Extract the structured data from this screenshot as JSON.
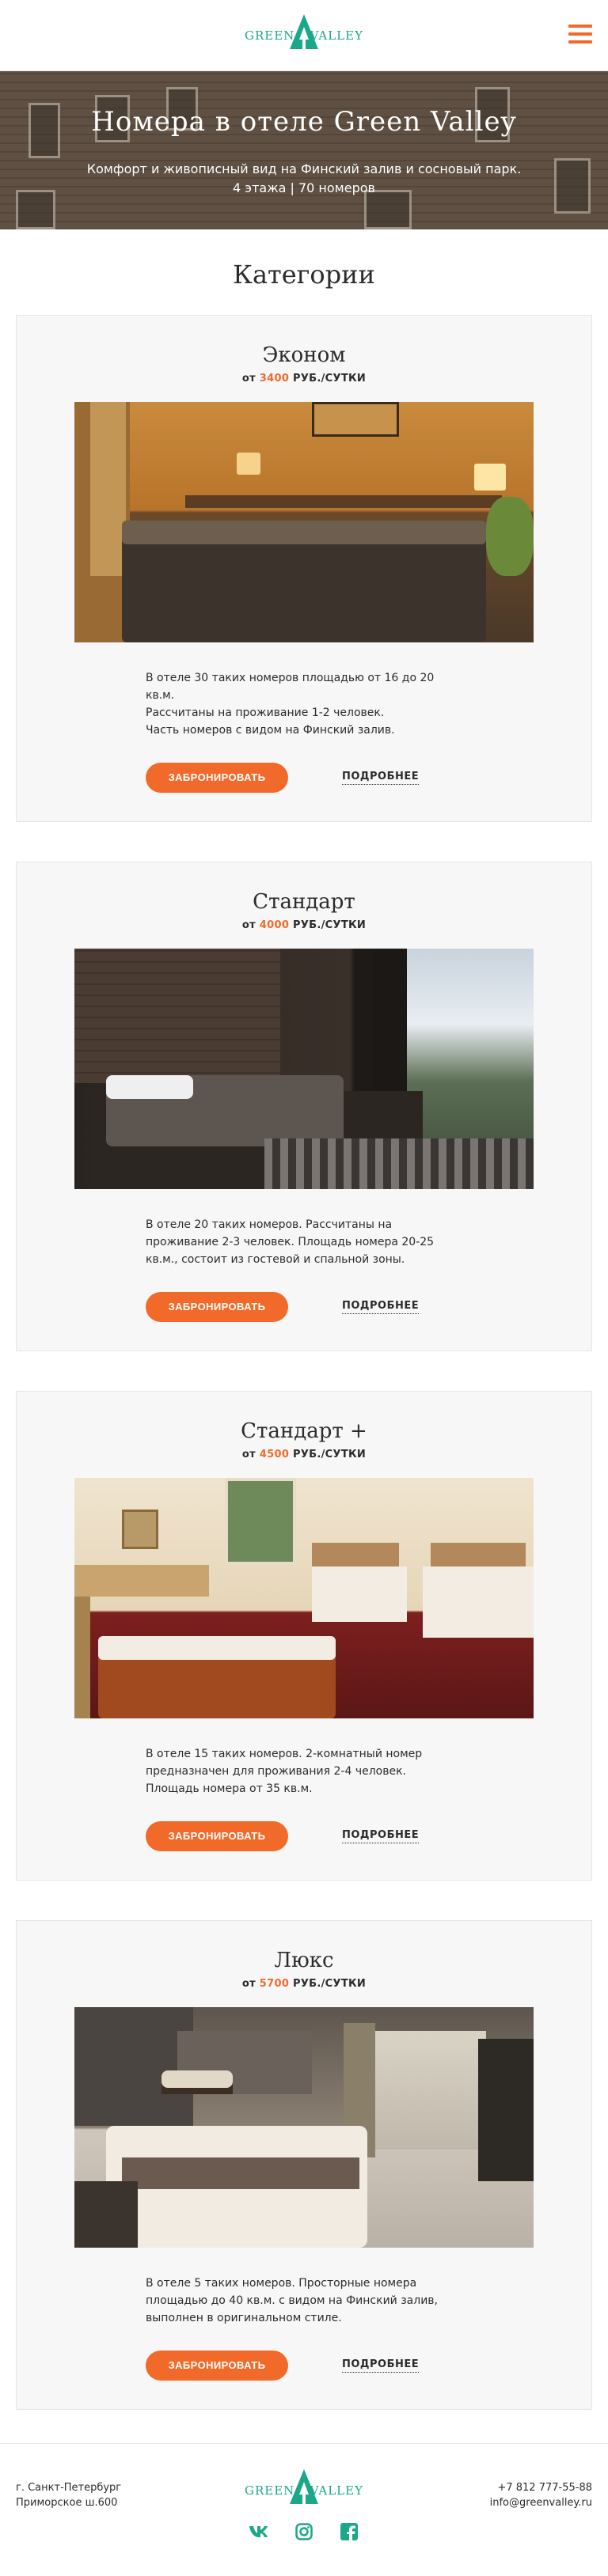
{
  "brand": {
    "left": "GREEN",
    "right": "VALLEY",
    "accent": "#1aa889",
    "orange": "#f26a2a"
  },
  "hero": {
    "title": "Номера в отеле Green Valley",
    "line1": "Комфорт и живописный вид на Финский залив и сосновый парк.",
    "line2": "4 этажа | 70 номеров"
  },
  "categories_title": "Категории",
  "rooms": [
    {
      "name": "Эконом",
      "from": "от",
      "price": "3400",
      "unit": "РУБ./СУТКИ",
      "desc": [
        "В отеле 30 таких номеров площадью от 16 до 20 кв.м.",
        "Рассчитаны на проживание 1-2 человек.",
        "Часть номеров с видом на Финский залив."
      ],
      "book": "ЗАБРОНИРОВАТЬ",
      "more": "ПОДРОБНЕЕ"
    },
    {
      "name": "Стандарт",
      "from": "от",
      "price": "4000",
      "unit": "РУБ./СУТКИ",
      "desc": [
        "В отеле 20 таких номеров. Рассчитаны на",
        "проживание 2-3 человек. Площадь номера 20-25",
        "кв.м., состоит из гостевой и спальной зоны."
      ],
      "book": "ЗАБРОНИРОВАТЬ",
      "more": "ПОДРОБНЕЕ"
    },
    {
      "name": "Стандарт +",
      "from": "от",
      "price": "4500",
      "unit": "РУБ./СУТКИ",
      "desc": [
        "В отеле 15 таких номеров. 2-комнатный номер",
        "предназначен для проживания 2-4 человек.",
        "Площадь номера от 35 кв.м."
      ],
      "book": "ЗАБРОНИРОВАТЬ",
      "more": "ПОДРОБНЕЕ"
    },
    {
      "name": "Люкс",
      "from": "от",
      "price": "5700",
      "unit": "РУБ./СУТКИ",
      "desc": [
        "В отеле 5 таких номеров. Просторные номера",
        "площадью до 40 кв.м. с видом на Финский залив,",
        "выполнен в оригинальном стиле."
      ],
      "book": "ЗАБРОНИРОВАТЬ",
      "more": "ПОДРОБНЕЕ"
    }
  ],
  "footer": {
    "city": "г. Санкт-Петербург",
    "street": "Приморское ш.600",
    "phone": "+7 812 777-55-88",
    "email": "info@greenvalley.ru",
    "social": [
      "vk-icon",
      "instagram-icon",
      "facebook-icon"
    ]
  }
}
